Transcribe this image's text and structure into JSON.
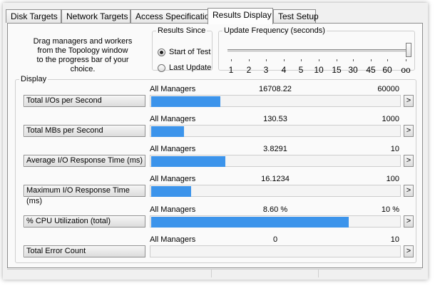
{
  "tabs": [
    {
      "label": "Disk Targets",
      "active": false
    },
    {
      "label": "Network Targets",
      "active": false
    },
    {
      "label": "Access Specifications",
      "active": false
    },
    {
      "label": "Results Display",
      "active": true
    },
    {
      "label": "Test Setup",
      "active": false
    }
  ],
  "instructions": {
    "line1": "Drag managers and workers",
    "line2": "from the Topology window",
    "line3": "to the progress bar of your choice."
  },
  "results_since": {
    "title": "Results Since",
    "options": [
      {
        "label": "Start of Test",
        "checked": true
      },
      {
        "label": "Last Update",
        "checked": false
      }
    ]
  },
  "update_frequency": {
    "title": "Update Frequency (seconds)",
    "ticks": [
      "1",
      "2",
      "3",
      "4",
      "5",
      "10",
      "15",
      "30",
      "45",
      "60",
      "oo"
    ],
    "selected": "oo"
  },
  "display": {
    "title": "Display",
    "arrow_label": ">",
    "bar_color": "#3c94eb",
    "rows": [
      {
        "metric": "Total I/Os per Second",
        "manager": "All Managers",
        "value": "16708.22",
        "max": "60000",
        "fill": 0.278
      },
      {
        "metric": "Total MBs per Second",
        "manager": "All Managers",
        "value": "130.53",
        "max": "1000",
        "fill": 0.131
      },
      {
        "metric": "Average I/O Response Time (ms)",
        "manager": "All Managers",
        "value": "3.8291",
        "max": "10",
        "fill": 0.298
      },
      {
        "metric": "Maximum I/O Response Time (ms)",
        "manager": "All Managers",
        "value": "16.1234",
        "max": "100",
        "fill": 0.161
      },
      {
        "metric": "% CPU Utilization (total)",
        "manager": "All Managers",
        "value": "8.60 %",
        "max": "10 %",
        "fill": 0.79
      },
      {
        "metric": "Total Error Count",
        "manager": "All Managers",
        "value": "0",
        "max": "10",
        "fill": 0
      }
    ]
  }
}
